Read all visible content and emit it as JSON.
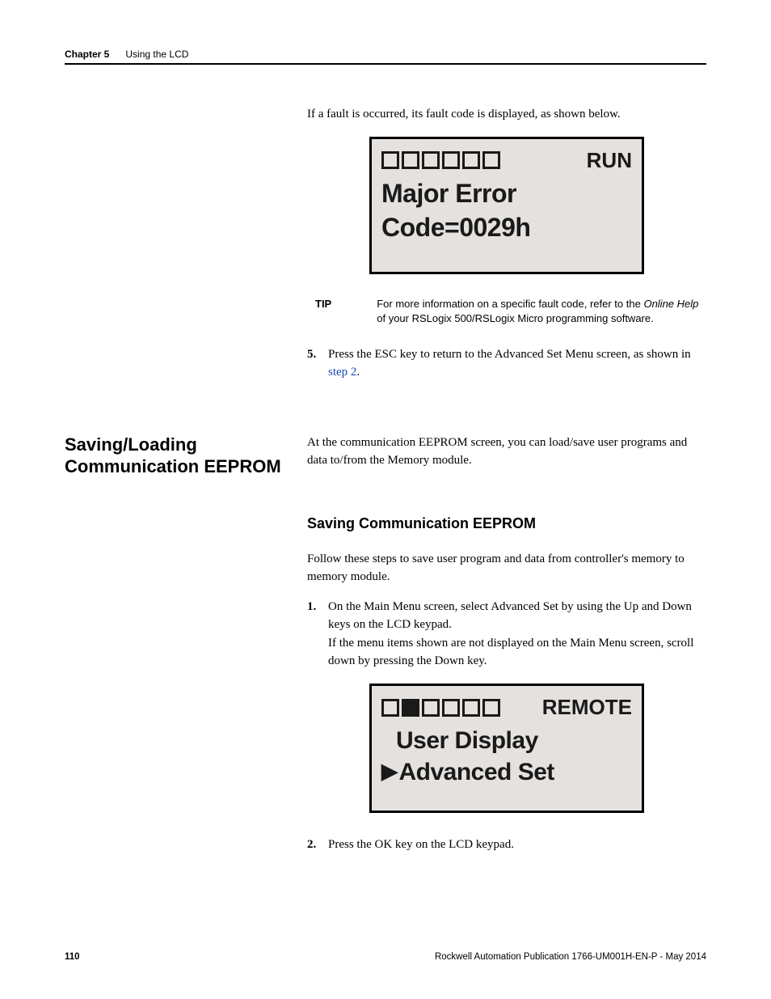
{
  "header": {
    "chapter_label": "Chapter 5",
    "chapter_title": "Using the LCD"
  },
  "intro_para": "If a fault is occurred, its fault code is displayed, as shown below.",
  "lcd_fault": {
    "status": "RUN",
    "squares_filled": [
      false,
      false,
      false,
      false,
      false,
      false
    ],
    "line1": "Major Error",
    "line2": "Code=0029h"
  },
  "tip": {
    "label": "TIP",
    "text_before_italic": "For more information on a specific fault code, refer to the ",
    "italic": "Online Help",
    "text_after_italic": " of your RSLogix 500/RSLogix Micro programming software."
  },
  "step5": {
    "num": "5.",
    "text_before_link": "Press the ESC key to return to the Advanced Set Menu screen, as shown in ",
    "link": "step 2",
    "text_after_link": "."
  },
  "section": {
    "heading": "Saving/Loading Communication EEPROM",
    "intro": "At the communication EEPROM screen, you can load/save user programs and data to/from the Memory module."
  },
  "sub_section": {
    "heading": "Saving Communication EEPROM",
    "intro": "Follow these steps to save user program and data from controller's memory to memory module."
  },
  "step1": {
    "num": "1.",
    "line1": "On the Main Menu screen, select Advanced Set by using the Up and Down keys on the LCD keypad.",
    "line2": "If the menu items shown are not displayed on the Main Menu screen, scroll down by pressing the Down key."
  },
  "lcd_menu": {
    "status": "REMOTE",
    "squares_filled": [
      false,
      true,
      false,
      false,
      false,
      false
    ],
    "menu_line1": "User Display",
    "menu_line2": "Advanced Set"
  },
  "step2": {
    "num": "2.",
    "text": "Press the OK key on the LCD keypad."
  },
  "footer": {
    "page": "110",
    "pub": "Rockwell Automation Publication 1766-UM001H-EN-P - May 2014"
  }
}
